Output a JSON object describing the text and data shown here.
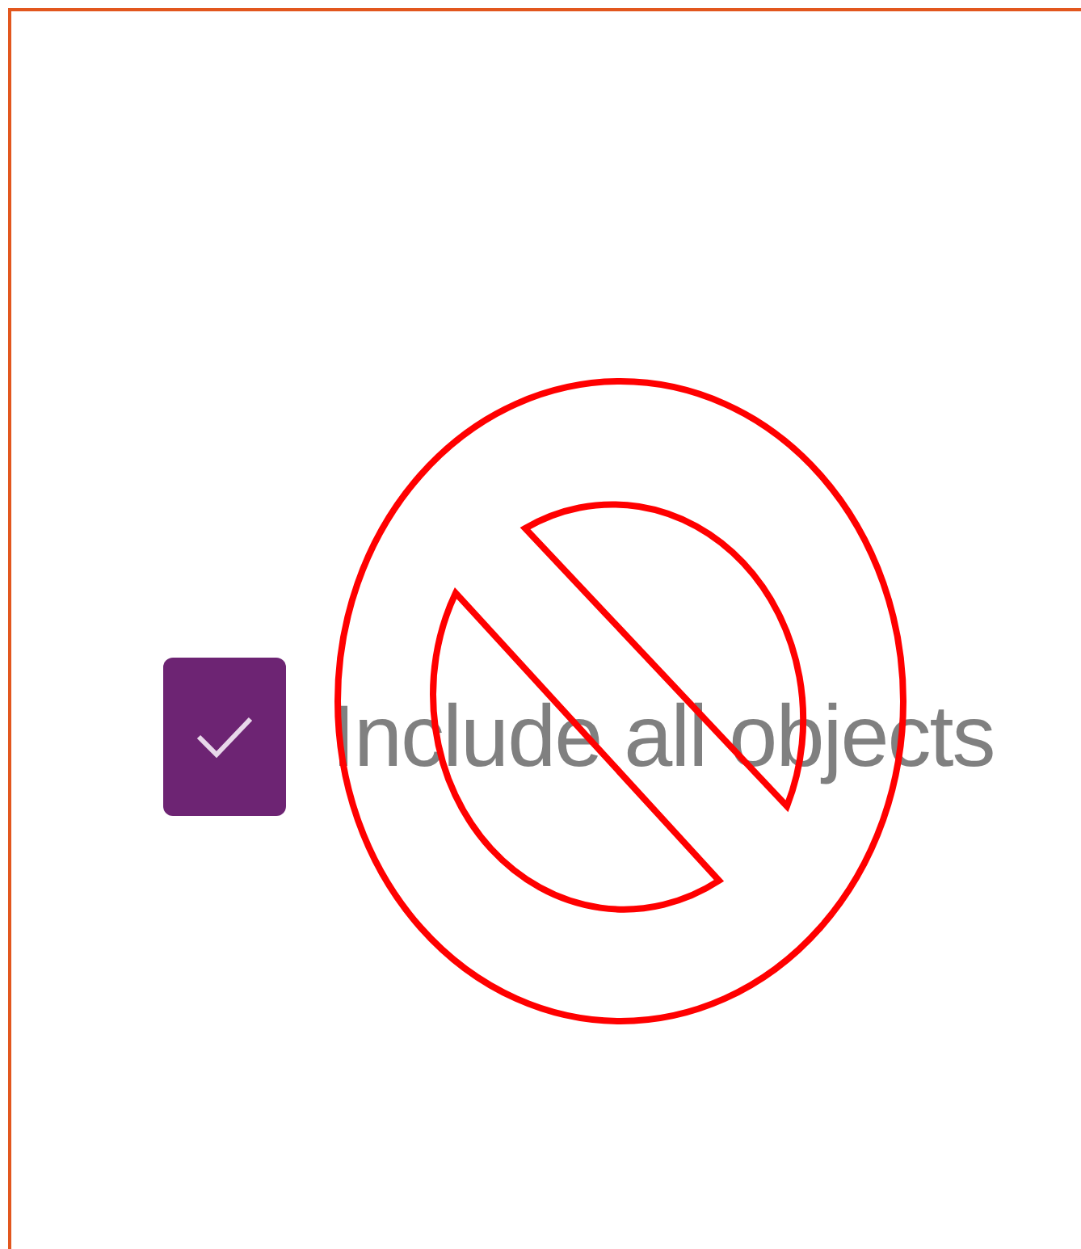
{
  "checkbox": {
    "label": "Include all objects",
    "checked": true
  }
}
